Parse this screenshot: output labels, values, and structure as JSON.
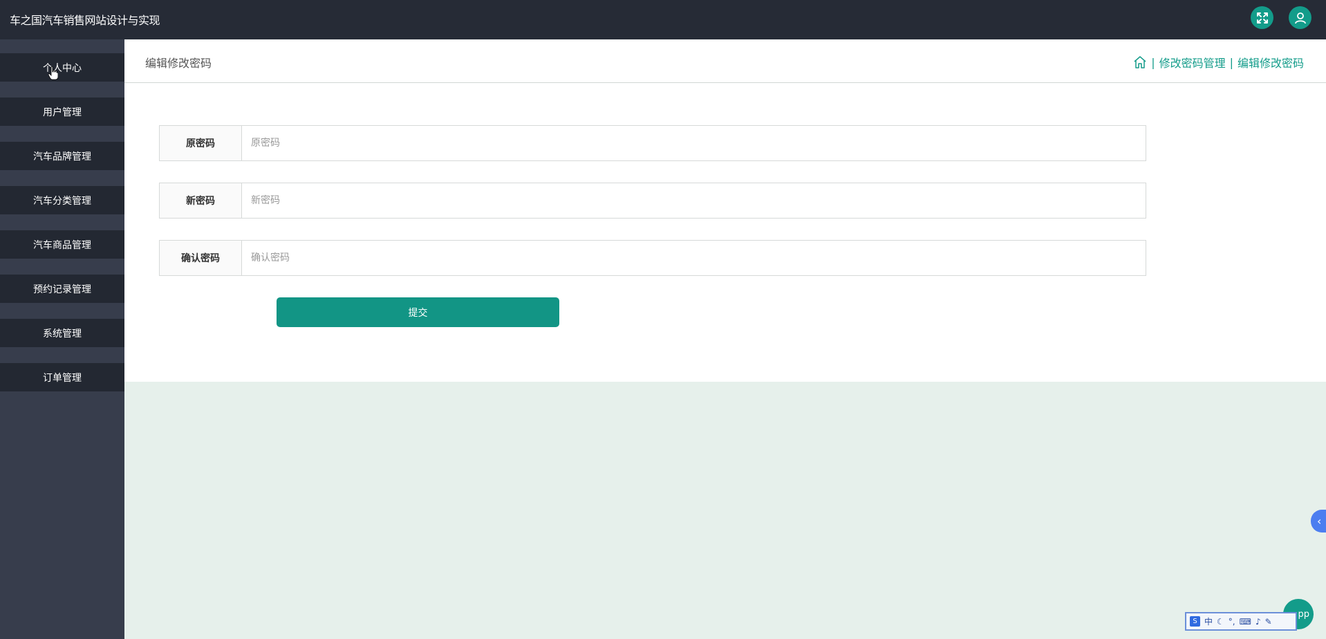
{
  "header": {
    "app_title": "车之国汽车销售网站设计与实现"
  },
  "sidebar": {
    "items": [
      {
        "label": "个人中心"
      },
      {
        "label": "用户管理"
      },
      {
        "label": "汽车品牌管理"
      },
      {
        "label": "汽车分类管理"
      },
      {
        "label": "汽车商品管理"
      },
      {
        "label": "预约记录管理"
      },
      {
        "label": "系统管理"
      },
      {
        "label": "订单管理"
      }
    ]
  },
  "page": {
    "title": "编辑修改密码",
    "breadcrumb": {
      "items": [
        "修改密码管理",
        "编辑修改密码"
      ],
      "separator": "|"
    }
  },
  "form": {
    "fields": [
      {
        "label": "原密码",
        "placeholder": "原密码",
        "value": ""
      },
      {
        "label": "新密码",
        "placeholder": "新密码",
        "value": ""
      },
      {
        "label": "确认密码",
        "placeholder": "确认密码",
        "value": ""
      }
    ],
    "submit_label": "提交"
  },
  "floating": {
    "app_badge_label": "pp",
    "ime": {
      "mode": "中"
    }
  },
  "colors": {
    "accent": "#139c8a",
    "topbar": "#262b36",
    "sidebar": "#373d4c",
    "menu_item": "#232832",
    "content_bg": "#e6f0eb"
  },
  "icons": {
    "fullscreen": "expand-arrows-icon",
    "user": "user-icon",
    "home": "home-icon"
  }
}
